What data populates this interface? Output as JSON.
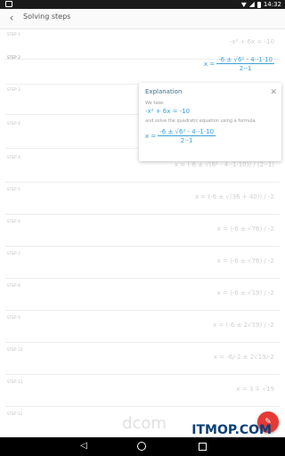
{
  "status": {
    "time": "14:32"
  },
  "toolbar": {
    "title": "Solving steps"
  },
  "steps": [
    {
      "label": "STEP 1",
      "expr": "-x² + 6x = -10"
    },
    {
      "label": "STEP 2",
      "expr": "x = (-6 ± √(6² - 4·-1·10)) / (2·-1)"
    },
    {
      "label": "STEP 3",
      "expr": ""
    },
    {
      "label": "STEP 4",
      "expr": "x = (-6 ± √(6² - 4·-1·10)) / (2·-1)"
    },
    {
      "label": "STEP 5",
      "expr": "x = (-6 ± √(36 + 40)) / -2"
    },
    {
      "label": "STEP 6",
      "expr": "x = (-6 ± √76) / -2"
    },
    {
      "label": "STEP 7",
      "expr": "x = (-6 ± √76) / -2"
    },
    {
      "label": "STEP 8",
      "expr": "x = (-6 ± √19) / -2"
    },
    {
      "label": "STEP 9",
      "expr": "x = (-6 ± 2√19) / -2"
    },
    {
      "label": "STEP 10",
      "expr": "x = -6/-2 ± 2√19/-2"
    },
    {
      "label": "STEP 11",
      "expr": "x = 3 ∓ √19"
    },
    {
      "label": "STEP 12",
      "expr": ""
    }
  ],
  "step2_formula": {
    "lhs": "x =",
    "numerator": "-6 ± √6² - 4·-1·10",
    "denominator": "2·-1"
  },
  "explanation": {
    "title": "Explanation",
    "we_take": "We take:",
    "equation": "-x² + 6x = -10",
    "solve_text": "and solve the quadratic equation using a formula",
    "formula_lhs": "x =",
    "formula_numerator": "-6 ± √6² - 4·-1·10",
    "formula_denominator": "2·-1"
  },
  "watermark": {
    "logo_text": "dcom",
    "site_text": "ITMOP.COM"
  },
  "icons": {
    "back": "back-arrow-icon",
    "close": "close-icon",
    "fab": "edit-icon"
  },
  "colors": {
    "accent": "#3aa1d6",
    "fab": "#e53935"
  }
}
